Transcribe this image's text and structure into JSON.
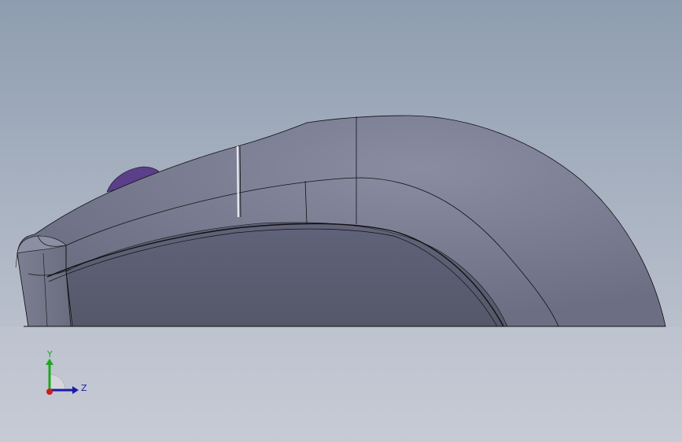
{
  "viewport": {
    "background_top": "#8e9db0",
    "background_bottom": "#c9ccd6"
  },
  "model": {
    "body_color": "#6e7186",
    "body_light": "#8a8da2",
    "side_color": "#5a5d6e",
    "scroll_wheel_color": "#5a3f8a",
    "edge_color": "#111111"
  },
  "triad": {
    "y_label": "Y",
    "z_label": "Z",
    "y_color": "#1fa81f",
    "z_color": "#1a1aa8",
    "x_color": "#c81e1e"
  }
}
